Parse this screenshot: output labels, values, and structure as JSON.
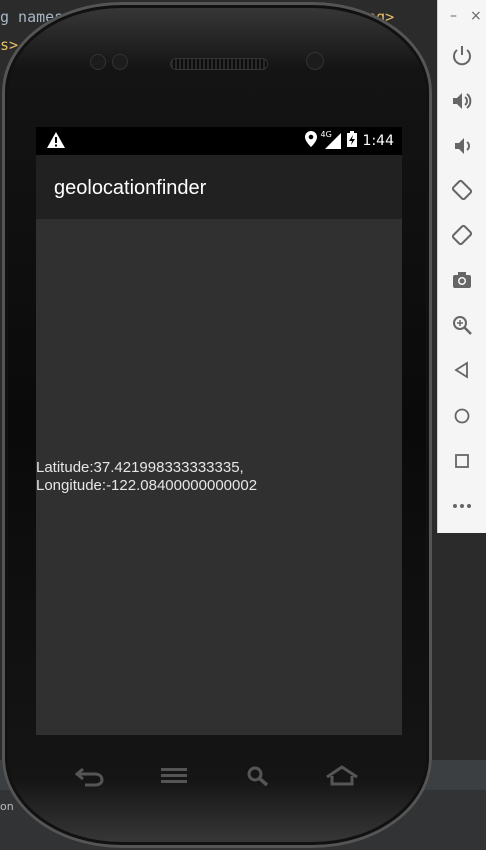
{
  "ide": {
    "line1_left": "g names",
    "line1_right": "tring>",
    "line2": "s>",
    "bottom_text": "on"
  },
  "device": {
    "status_time": "1:44",
    "network_label": "4G"
  },
  "app": {
    "title": "geolocationfinder",
    "latitude_text": "Latitude:37.421998333333335,",
    "longitude_text": "Longitude:-122.08400000000002"
  },
  "toolbar": {
    "minimize_label": "–",
    "close_label": "×",
    "items": [
      {
        "icon": "power-icon"
      },
      {
        "icon": "volume-up-icon"
      },
      {
        "icon": "volume-down-icon"
      },
      {
        "icon": "rotate-left-icon"
      },
      {
        "icon": "rotate-right-icon"
      },
      {
        "icon": "camera-icon"
      },
      {
        "icon": "zoom-icon"
      },
      {
        "icon": "back-icon"
      },
      {
        "icon": "home-icon"
      },
      {
        "icon": "overview-icon"
      },
      {
        "icon": "more-icon"
      }
    ]
  },
  "colors": {
    "toolbar_icon": "#3a7bd5",
    "app_bar": "#212121",
    "content_bg": "#303030"
  }
}
